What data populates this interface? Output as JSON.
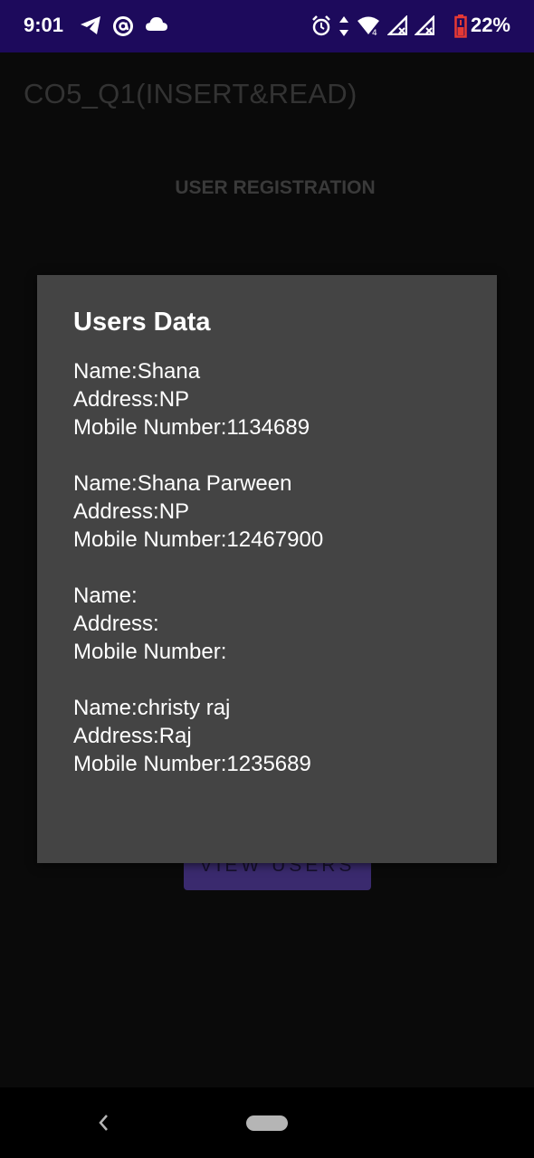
{
  "status_bar": {
    "time": "9:01",
    "battery": "22%",
    "icons_left": [
      "telegram-icon",
      "at-sign-icon",
      "cloud-icon"
    ],
    "icons_right": [
      "alarm-icon",
      "data-arrows-icon",
      "wifi-icon",
      "signal-icon",
      "signal-icon",
      "battery-icon"
    ]
  },
  "app": {
    "title": "CO5_Q1(INSERT&READ)",
    "heading": "USER REGISTRATION",
    "view_button": "VIEW USERS"
  },
  "dialog": {
    "title": "Users Data",
    "users": [
      {
        "name": "Name:Shana",
        "address": "Address:NP",
        "mobile": "Mobile Number:1134689"
      },
      {
        "name": "Name:Shana Parween",
        "address": "Address:NP",
        "mobile": "Mobile Number:12467900"
      },
      {
        "name": "Name:",
        "address": "Address:",
        "mobile": "Mobile Number:"
      },
      {
        "name": "Name:christy raj",
        "address": "Address:Raj",
        "mobile": "Mobile Number:1235689"
      }
    ]
  },
  "colors": {
    "status_bar_bg": "#1d0a5c",
    "dialog_bg": "#444444",
    "button_bg": "#3a2a6e",
    "battery_low": "#e53935"
  }
}
